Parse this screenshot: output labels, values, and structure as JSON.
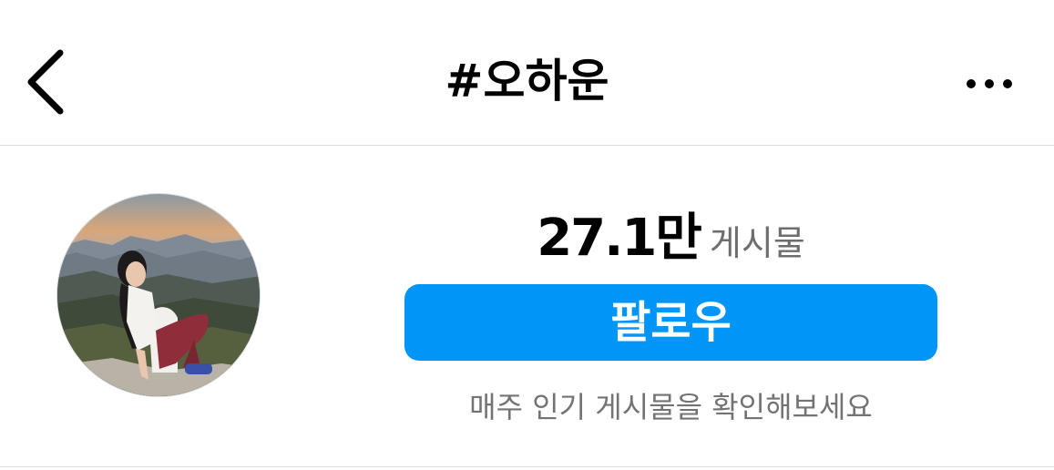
{
  "header": {
    "title": "#오하운",
    "back_icon": "chevron-left-icon",
    "more_icon": "ellipsis-horizontal-icon"
  },
  "hashtag": {
    "post_count": "27.1만",
    "post_count_label": "게시물",
    "follow_label": "팔로우",
    "subtitle": "매주 인기 게시물을 확인해보세요"
  },
  "colors": {
    "follow_button": "#0095f6",
    "divider": "#dbdbdb",
    "muted_text": "#737373"
  }
}
